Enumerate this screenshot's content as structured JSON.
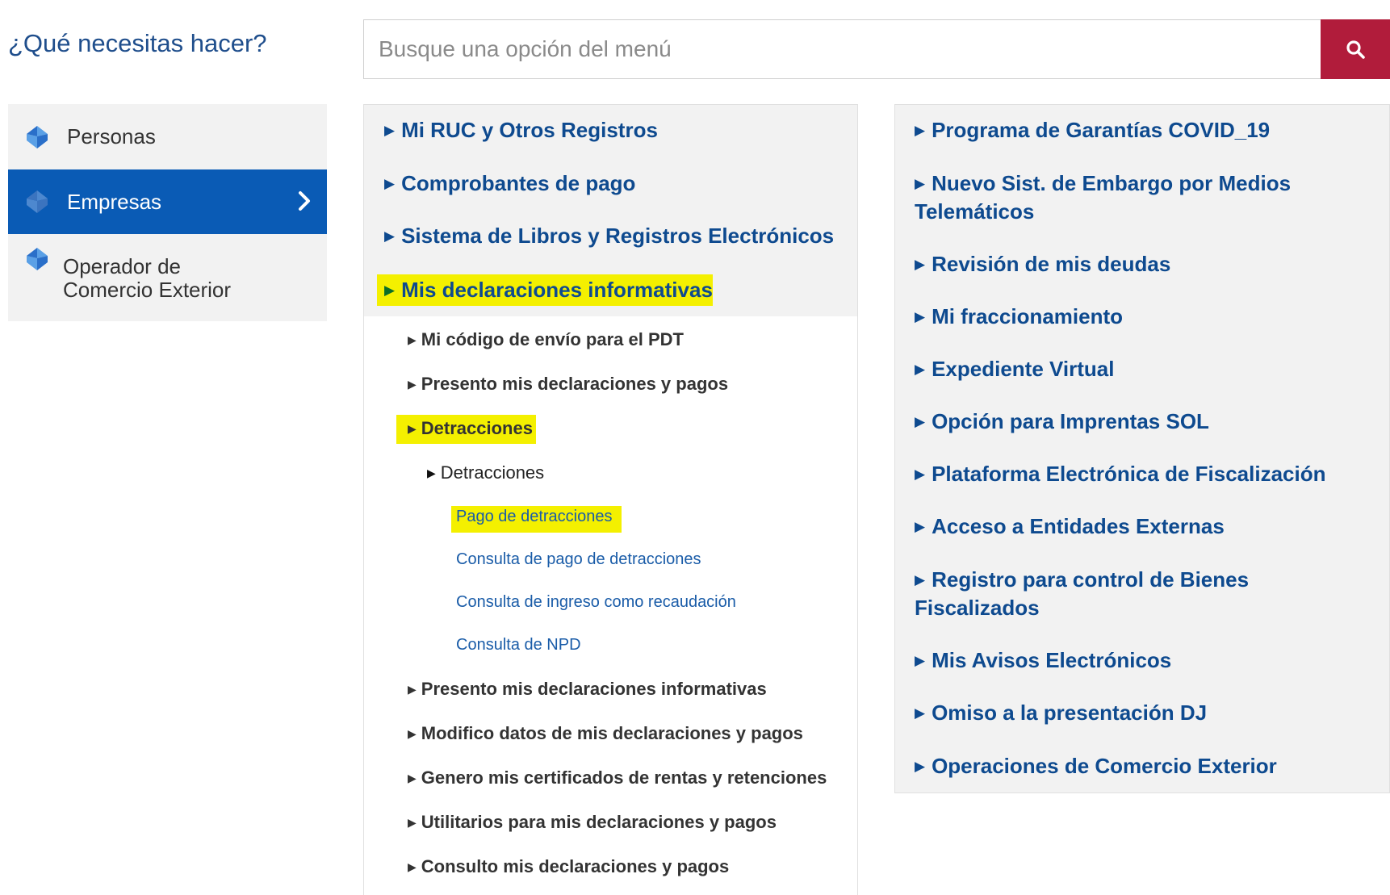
{
  "header": {
    "heading": "¿Qué necesitas hacer?",
    "search_placeholder": "Busque una opción del menú"
  },
  "sidebar": {
    "items": [
      {
        "label": "Personas",
        "active": false
      },
      {
        "label": "Empresas",
        "active": true
      },
      {
        "label": "Operador de Comercio Exterior",
        "active": false
      }
    ]
  },
  "middle": {
    "categories": [
      "Mi RUC y Otros Registros",
      "Comprobantes de pago",
      "Sistema de Libros y Registros Electrónicos",
      "Mis declaraciones informativas"
    ],
    "subitems_top": [
      "Mi código de envío para el PDT",
      "Presento mis declaraciones y pagos",
      "Detracciones"
    ],
    "subsub": "Detracciones",
    "links": [
      "Pago de detracciones",
      "Consulta de pago de detracciones",
      "Consulta de ingreso como recaudación",
      "Consulta de NPD"
    ],
    "subitems_bottom": [
      "Presento mis declaraciones informativas",
      "Modifico datos de mis declaraciones y pagos",
      "Genero mis certificados de rentas y retenciones",
      "Utilitarios para mis declaraciones y pagos",
      "Consulto mis declaraciones y pagos"
    ]
  },
  "right": {
    "categories": [
      "Programa de Garantías COVID_19",
      "Nuevo Sist. de Embargo por Medios Telemáticos",
      "Revisión de mis deudas",
      "Mi fraccionamiento",
      "Expediente Virtual",
      "Opción para Imprentas SOL",
      "Plataforma Electrónica de Fiscalización",
      "Acceso a Entidades Externas",
      "Registro para control de Bienes Fiscalizados",
      "Mis Avisos Electrónicos",
      "Omiso a la presentación DJ",
      "Operaciones de Comercio Exterior"
    ]
  },
  "colors": {
    "brand_blue": "#0a5bb5",
    "link_blue": "#0e4a8f",
    "search_button": "#b11c3b",
    "highlight": "#f4f000"
  }
}
